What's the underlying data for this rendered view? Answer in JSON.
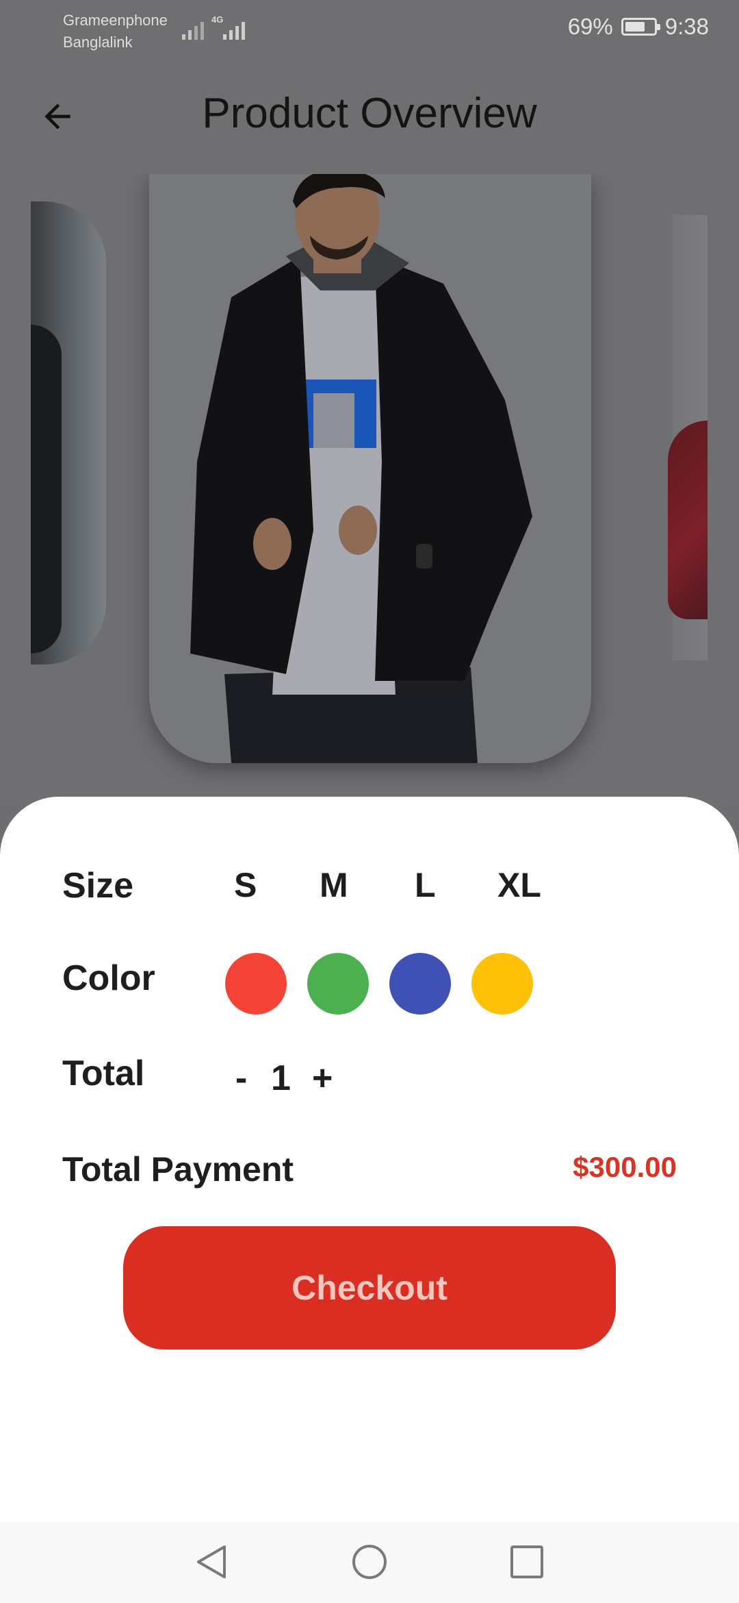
{
  "status_bar": {
    "carrier_1": "Grameenphone",
    "carrier_2": "Banglalink",
    "network_type": "4G",
    "battery_percent": "69%",
    "battery_level": 0.69,
    "time": "9:38",
    "icons": [
      "signal-icon",
      "signal-icon",
      "battery-icon"
    ]
  },
  "app_bar": {
    "back_icon": "arrow-left-icon",
    "title": "Product Overview"
  },
  "carousel": {
    "items": [
      "product-image-previous",
      "product-image-current",
      "product-image-next"
    ]
  },
  "details": {
    "size_label": "Size",
    "sizes": [
      "S",
      "M",
      "L",
      "XL"
    ],
    "color_label": "Color",
    "colors": [
      "#f44336",
      "#4caf50",
      "#3f51b5",
      "#ffc107"
    ],
    "total_label": "Total",
    "decrement": "-",
    "quantity": "1",
    "increment": "+",
    "payment_label": "Total Payment",
    "payment_amount": "$300.00",
    "checkout_label": "Checkout"
  },
  "nav_bar": {
    "icons": [
      "back-triangle-icon",
      "home-circle-icon",
      "recents-square-icon"
    ]
  },
  "colors": {
    "accent": "#db2e22",
    "price": "#d93324",
    "overlay": "#6f6e71"
  }
}
